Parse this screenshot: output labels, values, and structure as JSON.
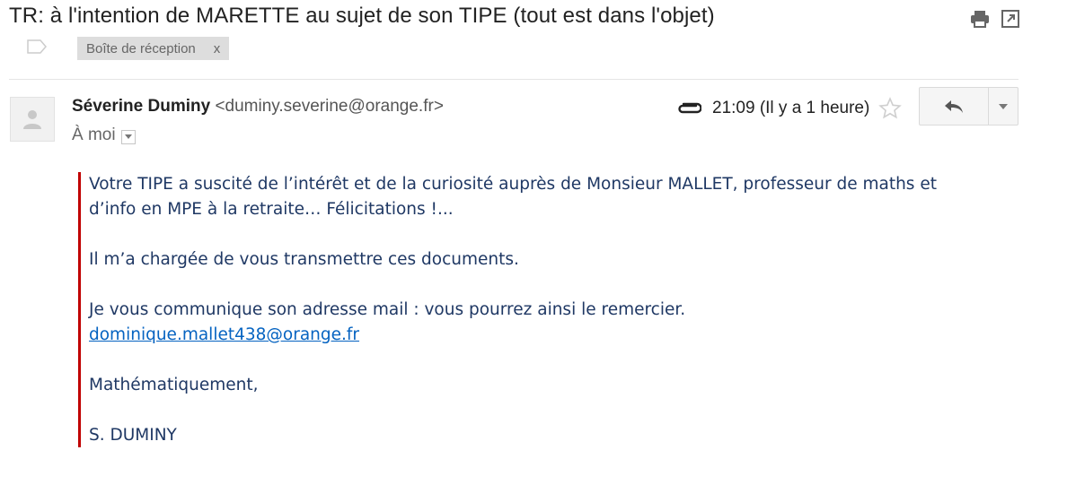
{
  "email": {
    "subject": "TR: à l'intention de MARETTE au sujet de son TIPE  (tout est dans l'objet)",
    "label": "Boîte de réception",
    "label_remove": "x",
    "sender_name": "Séverine Duminy",
    "sender_email": "<duminy.severine@orange.fr>",
    "recipient": "À moi",
    "time": "21:09 (Il y a 1 heure)",
    "body": {
      "p1": "Votre TIPE a suscité de l’intérêt et de la curiosité auprès de Monsieur MALLET, professeur de maths et d’info en MPE à la retraite… Félicitations !...",
      "p2": "Il m’a chargée de vous transmettre ces documents.",
      "p3": "Je vous communique son adresse mail : vous pourrez ainsi le remercier.",
      "link": "dominique.mallet438@orange.fr",
      "p4": "Mathématiquement,",
      "signature": "S. DUMINY"
    }
  },
  "icons": {
    "print": "print-icon",
    "popout": "new-window-icon",
    "label": "label-icon",
    "avatar": "person-icon",
    "attachment": "paperclip-icon",
    "star": "star-icon",
    "reply": "reply-icon",
    "more": "chevron-down-icon"
  },
  "colors": {
    "body_text": "#1f3864",
    "quote_bar": "#c00000",
    "link": "#0563c1"
  }
}
